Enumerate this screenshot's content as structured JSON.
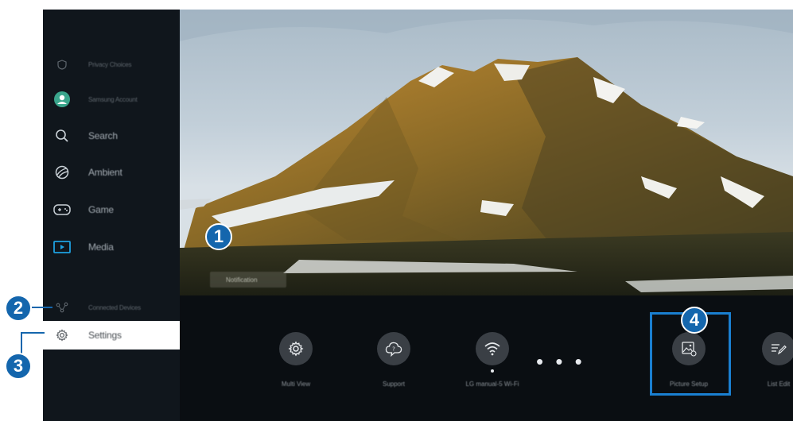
{
  "sidebar": {
    "items": [
      {
        "label": "Privacy Choices",
        "icon": "shield-icon"
      },
      {
        "label": "Samsung Account",
        "icon": "account-icon"
      },
      {
        "label": "Search",
        "icon": "search-icon"
      },
      {
        "label": "Ambient",
        "icon": "ambient-icon"
      },
      {
        "label": "Game",
        "icon": "gamepad-icon"
      },
      {
        "label": "Media",
        "icon": "media-icon"
      },
      {
        "label": "Connected Devices",
        "icon": "connected-devices-icon"
      },
      {
        "label": "Settings",
        "icon": "gear-icon"
      }
    ]
  },
  "hero": {
    "ghost_label": "Notification"
  },
  "quick_settings": [
    {
      "label": "Multi View",
      "icon": "gear-icon"
    },
    {
      "label": "Support",
      "icon": "support-cloud-icon"
    },
    {
      "label": "LG manual-5 Wi-Fi",
      "icon": "wifi-icon"
    },
    {
      "label": "Picture Setup",
      "icon": "picture-setup-icon"
    },
    {
      "label": "List Edit",
      "icon": "list-edit-icon"
    }
  ],
  "more_label": "• • •",
  "callouts": [
    "1",
    "2",
    "3",
    "4"
  ],
  "colors": {
    "accent": "#1466ad",
    "focus": "#1a7fd0",
    "sidebar_bg": "#10161c"
  }
}
